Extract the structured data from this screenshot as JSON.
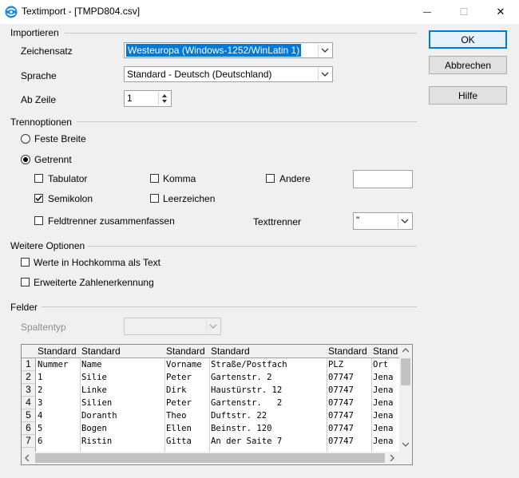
{
  "window": {
    "title": "Textimport - [TMPD804.csv]",
    "minimize_glyph": "—",
    "maximize_glyph": "☐",
    "close_glyph": "✕"
  },
  "buttons": {
    "ok": "OK",
    "cancel": "Abbrechen",
    "help": "Hilfe"
  },
  "import": {
    "section": "Importieren",
    "charset_label": "Zeichensatz",
    "charset_value": "Westeuropa (Windows-1252/WinLatin 1)",
    "language_label": "Sprache",
    "language_value": "Standard - Deutsch (Deutschland)",
    "from_row_label": "Ab Zeile",
    "from_row_value": "1"
  },
  "separator": {
    "section": "Trennoptionen",
    "fixed_width": "Feste Breite",
    "separated": "Getrennt",
    "tab": "Tabulator",
    "comma": "Komma",
    "other": "Andere",
    "other_value": "",
    "semicolon": "Semikolon",
    "space": "Leerzeichen",
    "merge": "Feldtrenner zusammenfassen",
    "text_delim_label": "Texttrenner",
    "text_delim_value": "\"",
    "state": {
      "fixed_width": false,
      "separated": true,
      "tab": false,
      "comma": false,
      "other": false,
      "semicolon": true,
      "space": false,
      "merge": false
    }
  },
  "other_options": {
    "section": "Weitere Optionen",
    "quoted_as_text": "Werte in Hochkomma als Text",
    "detect_numbers": "Erweiterte Zahlenerkennung"
  },
  "fields": {
    "section": "Felder",
    "column_type_label": "Spaltentyp",
    "column_type_value": "",
    "headers": [
      "Standard",
      "Standard",
      "Standard",
      "Standard",
      "Standard",
      "Stand"
    ],
    "row_numbers": [
      "1",
      "2",
      "3",
      "4",
      "5",
      "6",
      "7"
    ],
    "rows": [
      [
        "Nummer",
        "Name",
        "Vorname",
        "Straße/Postfach",
        "PLZ",
        "Ort"
      ],
      [
        "1",
        "Silie",
        "Peter",
        "Gartenstr. 2",
        "07747",
        "Jena"
      ],
      [
        "2",
        "Linke",
        "Dirk",
        "Haustürstr. 12",
        "07747",
        "Jena"
      ],
      [
        "3",
        "Silien",
        "Peter",
        "Gartenstr.   2",
        "07747",
        "Jena"
      ],
      [
        "4",
        "Doranth",
        "Theo",
        "Duftstr. 22",
        "07747",
        "Jena"
      ],
      [
        "5",
        "Bogen",
        "Ellen",
        "Beinstr. 120",
        "07747",
        "Jena"
      ],
      [
        "6",
        "Ristin",
        "Gitta",
        "An der Saite 7",
        "07747",
        "Jena"
      ]
    ]
  },
  "colors": {
    "accent": "#0078d7",
    "selection": "#0078d7"
  }
}
